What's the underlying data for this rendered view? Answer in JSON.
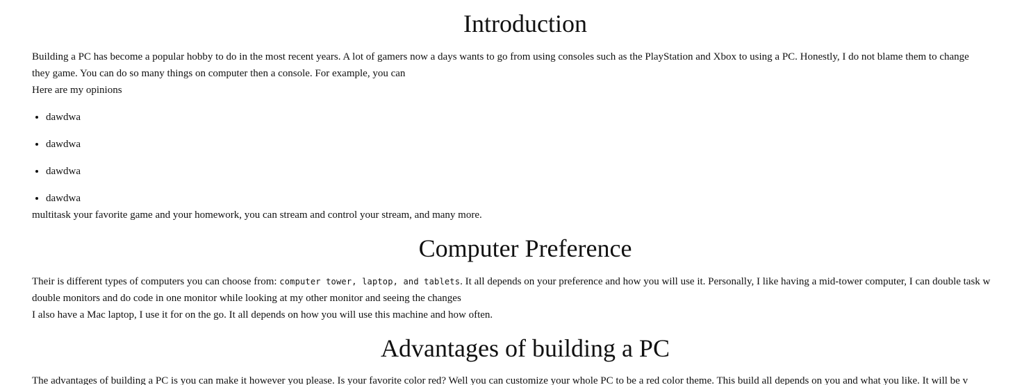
{
  "sections": {
    "introduction": {
      "heading": "Introduction",
      "para_line1": "Building a PC has become a popular hobby to do in the most recent years. A lot of gamers now a days wants to go from using consoles such as the PlayStation and Xbox to using a PC. Honestly, I do not blame them to change",
      "para_line2": "they game. You can do so many things on computer then a console. For example, you can",
      "opinions_label": "Here are my opinions",
      "opinions": [
        "dawdwa",
        "dawdwa",
        "dawdwa",
        "dawdwa"
      ],
      "tail": "multitask your favorite game and your homework, you can stream and control your stream, and many more."
    },
    "computer_preference": {
      "heading": "Computer Preference",
      "para_start": "Their is different types of computers you can choose from: ",
      "code_text": "computer tower, laptop, and tablets",
      "para_after_code": ". It all depends on your preference and how you will use it. Personally, I like having a mid-tower computer, I can double task w",
      "para_line2": "double monitors and do code in one monitor while looking at my other monitor and seeing the changes",
      "para_line3": "I also have a Mac laptop, I use it for on the go. It all depends on how you will use this machine and how often."
    },
    "advantages": {
      "heading": "Advantages of building a PC",
      "para_line1": "The advantages of building a PC is you can make it however you please. Is your favorite color red? Well you can customize your whole PC to be a red color theme. This build all depends on you and what you like. It will be v"
    }
  }
}
